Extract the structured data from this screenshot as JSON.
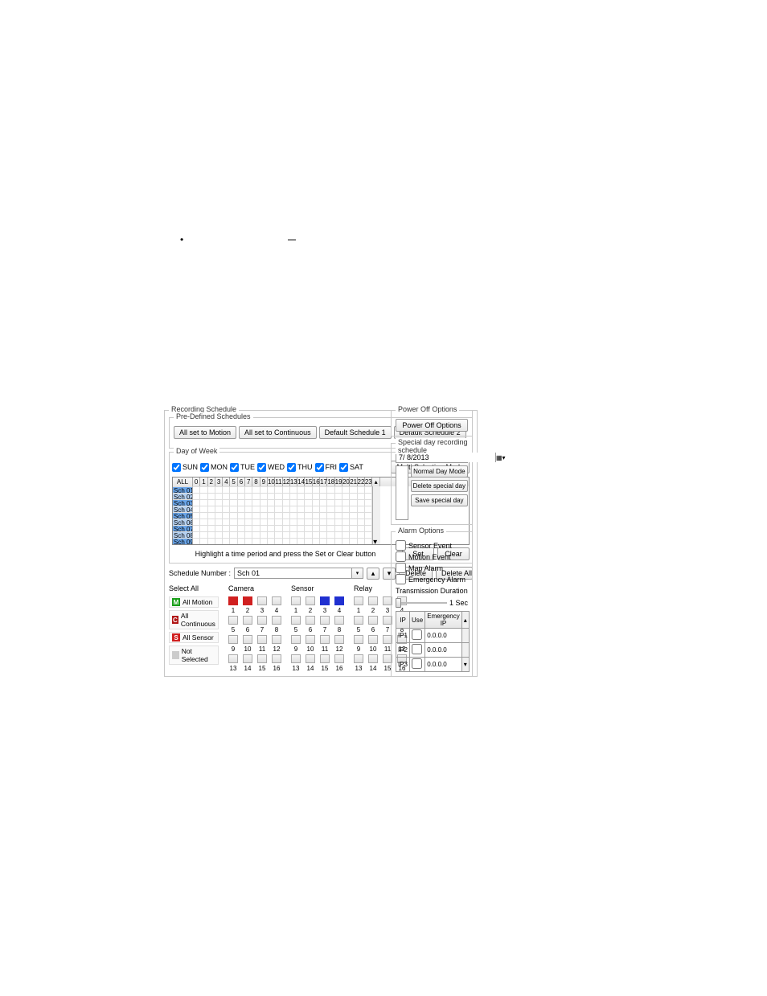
{
  "bullet": "•",
  "dialog_title": "Recording Schedule",
  "pre_defined": {
    "title": "Pre-Defined Schedules",
    "buttons": [
      "All set to Motion",
      "All set to Continuous",
      "Default Schedule 1",
      "Default Schedule 2"
    ]
  },
  "dow": {
    "title": "Day of Week",
    "days": [
      "SUN",
      "MON",
      "TUE",
      "WED",
      "THU",
      "FRI",
      "SAT"
    ],
    "multi_btn": "Multi Selection Mode"
  },
  "schedule_grid": {
    "all_label": "ALL",
    "hours": [
      "0",
      "1",
      "2",
      "3",
      "4",
      "5",
      "6",
      "7",
      "8",
      "9",
      "10",
      "11",
      "12",
      "13",
      "14",
      "15",
      "16",
      "17",
      "18",
      "19",
      "20",
      "21",
      "22",
      "23"
    ],
    "rows": [
      "Sch 01",
      "Sch 02",
      "Sch 03",
      "Sch 04",
      "Sch 05",
      "Sch 06",
      "Sch 07",
      "Sch 08",
      "Sch 09"
    ]
  },
  "help_text": "Highlight a time period and press the Set or Clear button",
  "set_btn": "Set",
  "clear_btn": "Clear",
  "schnum_label": "Schedule Number :",
  "schnum_value": "Sch 01",
  "delete_btn": "Delete",
  "delete_all_btn": "Delete All",
  "select_all": {
    "header": "Select All",
    "modes": [
      {
        "badge": "M",
        "label": "All Motion"
      },
      {
        "badge": "C",
        "label": "All Continuous"
      },
      {
        "badge": "S",
        "label": "All Sensor"
      },
      {
        "badge": "",
        "label": "Not Selected"
      }
    ]
  },
  "camera_header": "Camera",
  "sensor_header": "Sensor",
  "relay_header": "Relay",
  "grid_numbers": [
    "1",
    "2",
    "3",
    "4",
    "5",
    "6",
    "7",
    "8",
    "9",
    "10",
    "11",
    "12",
    "13",
    "14",
    "15",
    "16"
  ],
  "power_off": {
    "title": "Power Off Options",
    "btn": "Power Off Options"
  },
  "special_day": {
    "title": "Special day recording schedule",
    "date": "7/ 8/2013",
    "normal_btn": "Normal Day Mode",
    "delete_btn": "Delete special day",
    "save_btn": "Save special day"
  },
  "alarm": {
    "title": "Alarm Options",
    "checks": [
      "Sensor Event",
      "Motion Event",
      "Map Alarm",
      "Emergency Alarm"
    ],
    "trans_label": "Transmission Duration",
    "slider_val": "1 Sec",
    "ip_headers": [
      "IP",
      "Use",
      "Emergency IP"
    ],
    "ip_rows": [
      {
        "ip": "IP1",
        "use": false,
        "val": "0.0.0.0"
      },
      {
        "ip": "IP2",
        "use": false,
        "val": "0.0.0.0"
      },
      {
        "ip": "IP3",
        "use": false,
        "val": "0.0.0.0"
      }
    ]
  }
}
